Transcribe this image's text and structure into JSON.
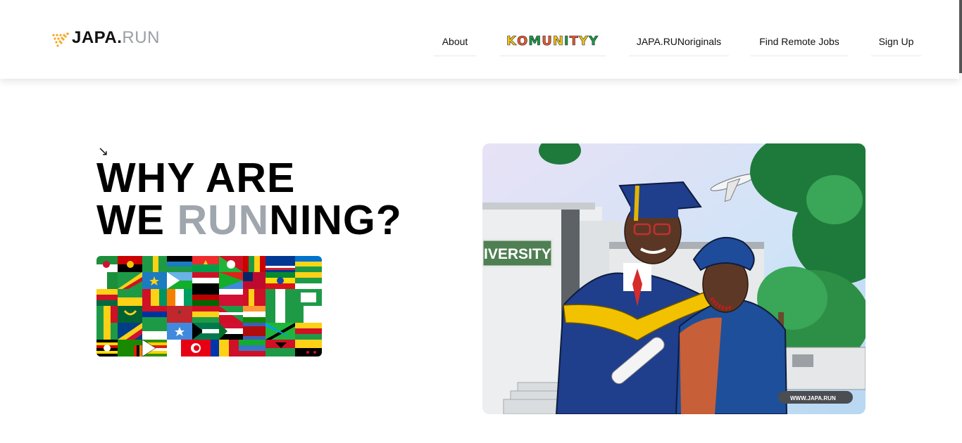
{
  "brand": {
    "name_dark": "JAPA.",
    "name_light": "RUN"
  },
  "nav": {
    "about": "About",
    "komunity": [
      "K",
      "O",
      "M",
      "U",
      "N",
      "I",
      "T",
      "Y",
      "Y"
    ],
    "originals": "JAPA.RUNoriginals",
    "jobs": "Find Remote Jobs",
    "signup": "Sign Up"
  },
  "hero": {
    "arrow": "↘",
    "line1": "WHY ARE",
    "line2_a": "WE ",
    "line2_b": "RUN",
    "line2_c": "NING?"
  },
  "illustration": {
    "sign_text": "IVERSITY",
    "watermark": "WWW.JAPA.RUN"
  },
  "colors": {
    "komunity": [
      "#f0c419",
      "#e8572a",
      "#1b9a4a",
      "#e8572a",
      "#f0c419",
      "#1b9a4a",
      "#e8572a",
      "#f0c419",
      "#1b9a4a"
    ]
  }
}
